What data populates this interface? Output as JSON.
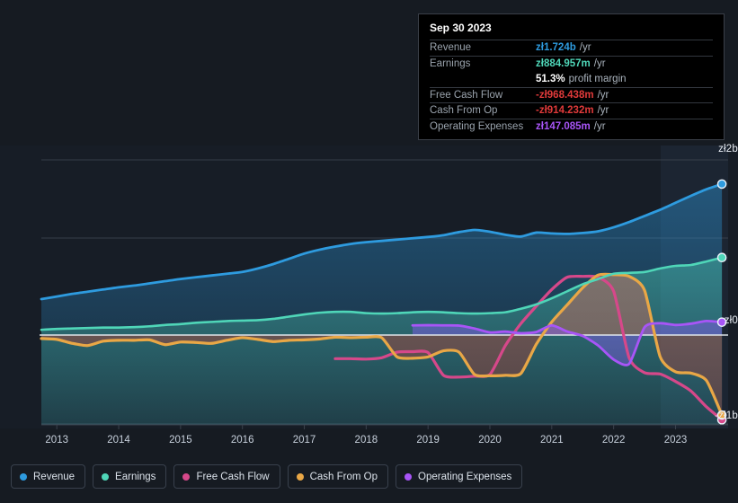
{
  "tooltip": {
    "date": "Sep 30 2023",
    "rows": [
      {
        "key": "Revenue",
        "value": "zł1.724b",
        "unit": "/yr",
        "color": "#2e9bdf"
      },
      {
        "key": "Earnings",
        "value": "zł884.957m",
        "unit": "/yr",
        "color": "#4fd6b8"
      },
      {
        "key": "",
        "value": "51.3%",
        "unit": "profit margin",
        "color": "#ffffff"
      },
      {
        "key": "Free Cash Flow",
        "value": "-zł968.438m",
        "unit": "/yr",
        "color": "#e03a3a"
      },
      {
        "key": "Cash From Op",
        "value": "-zł914.232m",
        "unit": "/yr",
        "color": "#e03a3a"
      },
      {
        "key": "Operating Expenses",
        "value": "zł147.085m",
        "unit": "/yr",
        "color": "#a855f7"
      }
    ]
  },
  "legend": [
    {
      "label": "Revenue",
      "color": "#2e9bdf"
    },
    {
      "label": "Earnings",
      "color": "#4fd6b8"
    },
    {
      "label": "Free Cash Flow",
      "color": "#d6488a"
    },
    {
      "label": "Cash From Op",
      "color": "#e9a746"
    },
    {
      "label": "Operating Expenses",
      "color": "#a855f7"
    }
  ],
  "axes": {
    "y_ticks": [
      {
        "label": "zł2b",
        "value": 2000
      },
      {
        "label": "zł0",
        "value": 0
      },
      {
        "label": "-zł1b",
        "value": -1000
      }
    ],
    "x_ticks": [
      "2013",
      "2014",
      "2015",
      "2016",
      "2017",
      "2018",
      "2019",
      "2020",
      "2021",
      "2022",
      "2023"
    ]
  },
  "chart_data": {
    "type": "area",
    "title": "",
    "xlabel": "",
    "ylabel": "",
    "currency": "zł",
    "unit": "millions",
    "ylim": [
      -1200,
      2100
    ],
    "xlim": [
      2012.75,
      2023.85
    ],
    "grid": true,
    "legend_position": "bottom",
    "x": [
      2012.75,
      2013.0,
      2013.25,
      2013.5,
      2013.75,
      2014.0,
      2014.25,
      2014.5,
      2014.75,
      2015.0,
      2015.25,
      2015.5,
      2015.75,
      2016.0,
      2016.25,
      2016.5,
      2016.75,
      2017.0,
      2017.25,
      2017.5,
      2017.75,
      2018.0,
      2018.25,
      2018.5,
      2018.75,
      2019.0,
      2019.25,
      2019.5,
      2019.75,
      2020.0,
      2020.25,
      2020.5,
      2020.75,
      2021.0,
      2021.25,
      2021.5,
      2021.75,
      2022.0,
      2022.25,
      2022.5,
      2022.75,
      2023.0,
      2023.25,
      2023.5,
      2023.75
    ],
    "series": [
      {
        "name": "Revenue",
        "color": "#2e9bdf",
        "values": [
          410,
          440,
          470,
          495,
          520,
          545,
          565,
          590,
          615,
          640,
          660,
          680,
          700,
          720,
          760,
          810,
          870,
          930,
          975,
          1010,
          1040,
          1060,
          1075,
          1090,
          1105,
          1120,
          1140,
          1175,
          1200,
          1180,
          1145,
          1125,
          1170,
          1160,
          1155,
          1165,
          1185,
          1230,
          1290,
          1360,
          1430,
          1510,
          1590,
          1665,
          1724
        ]
      },
      {
        "name": "Earnings",
        "color": "#4fd6b8",
        "values": [
          60,
          70,
          75,
          80,
          85,
          85,
          90,
          100,
          115,
          125,
          140,
          150,
          160,
          165,
          170,
          185,
          210,
          235,
          255,
          265,
          265,
          250,
          245,
          250,
          260,
          265,
          260,
          250,
          245,
          250,
          260,
          300,
          350,
          420,
          500,
          580,
          640,
          700,
          710,
          720,
          760,
          790,
          800,
          840,
          885
        ]
      },
      {
        "name": "Free Cash Flow",
        "color": "#d6488a",
        "values": [
          null,
          null,
          null,
          null,
          null,
          null,
          null,
          null,
          null,
          null,
          null,
          null,
          null,
          null,
          null,
          null,
          null,
          null,
          null,
          -270,
          -270,
          -275,
          -260,
          -195,
          -190,
          -200,
          -460,
          -480,
          -470,
          -450,
          -120,
          130,
          330,
          520,
          660,
          670,
          660,
          500,
          -260,
          -430,
          -445,
          -530,
          -640,
          -820,
          -968
        ]
      },
      {
        "name": "Cash From Op",
        "color": "#e9a746",
        "values": [
          -40,
          -50,
          -95,
          -120,
          -70,
          -60,
          -60,
          -55,
          -110,
          -80,
          -85,
          -95,
          -60,
          -30,
          -50,
          -75,
          -60,
          -55,
          -45,
          -25,
          -30,
          -25,
          -30,
          -250,
          -265,
          -250,
          -180,
          -195,
          -450,
          -465,
          -460,
          -440,
          -105,
          150,
          345,
          540,
          685,
          690,
          670,
          510,
          -245,
          -420,
          -435,
          -520,
          -914
        ]
      },
      {
        "name": "Operating Expenses",
        "color": "#a855f7",
        "values": [
          null,
          null,
          null,
          null,
          null,
          null,
          null,
          null,
          null,
          null,
          null,
          null,
          null,
          null,
          null,
          null,
          null,
          null,
          null,
          null,
          null,
          null,
          null,
          null,
          110,
          112,
          110,
          108,
          75,
          30,
          40,
          20,
          35,
          110,
          40,
          -10,
          -120,
          -280,
          -330,
          90,
          135,
          115,
          130,
          160,
          147
        ]
      }
    ]
  }
}
